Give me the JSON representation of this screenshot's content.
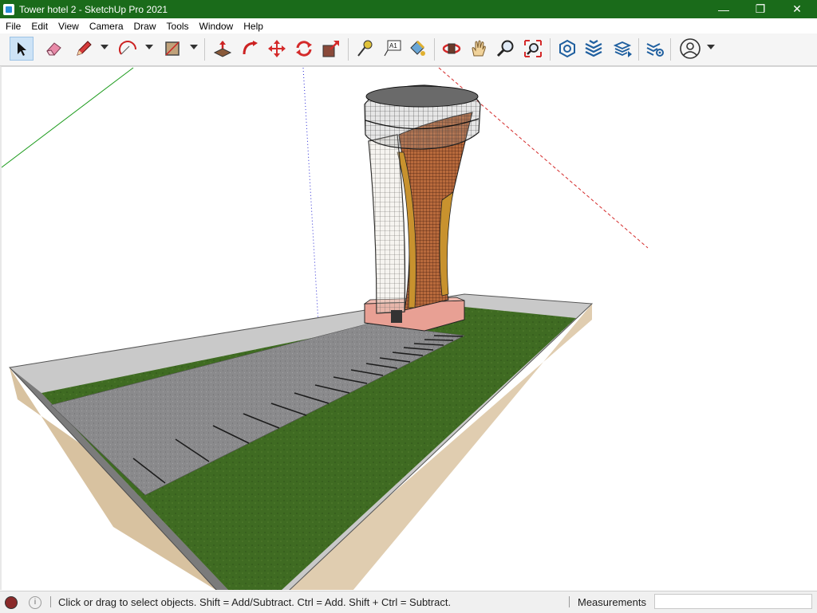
{
  "window": {
    "title": "Tower hotel 2 - SketchUp Pro 2021",
    "controls": {
      "minimize": "—",
      "maximize": "❐",
      "close": "✕"
    }
  },
  "menu": [
    "File",
    "Edit",
    "View",
    "Camera",
    "Draw",
    "Tools",
    "Window",
    "Help"
  ],
  "toolbar": {
    "tools": [
      {
        "icon": "select-arrow-icon",
        "active": true
      },
      {
        "icon": "eraser-icon"
      },
      {
        "icon": "pencil-icon",
        "dropdown": true
      },
      {
        "icon": "arc-icon",
        "dropdown": true
      },
      {
        "icon": "rectangle-icon",
        "dropdown": true
      },
      {
        "icon": "push-pull-icon"
      },
      {
        "icon": "follow-me-icon"
      },
      {
        "icon": "move-icon"
      },
      {
        "icon": "rotate-icon"
      },
      {
        "icon": "scale-icon"
      },
      {
        "icon": "tape-measure-icon"
      },
      {
        "icon": "text-tool-icon"
      },
      {
        "icon": "paint-bucket-icon"
      },
      {
        "icon": "orbit-icon"
      },
      {
        "icon": "pan-hand-icon"
      },
      {
        "icon": "zoom-icon"
      },
      {
        "icon": "zoom-extents-icon"
      },
      {
        "icon": "warehouse-icon"
      },
      {
        "icon": "extension-warehouse-icon"
      },
      {
        "icon": "layout-send-icon"
      },
      {
        "icon": "extension-manager-icon"
      },
      {
        "icon": "profile-icon",
        "dropdown": true
      }
    ],
    "text_tool_label": "A1"
  },
  "status": {
    "hint": "Click or drag to select objects. Shift = Add/Subtract. Ctrl = Add. Shift + Ctrl = Subtract.",
    "measurements_label": "Measurements",
    "measurements_value": ""
  },
  "colors": {
    "titlebar": "#1a6b1a",
    "grass": "#3f6b22",
    "asphalt": "#8a8a8c",
    "wall": "#c9c9c9",
    "tower_copper": "#b86a3c",
    "tower_gold": "#c8922e",
    "axis_red": "#d42a2a",
    "axis_green": "#1a9a1a",
    "axis_blue": "#2a2ad4"
  }
}
